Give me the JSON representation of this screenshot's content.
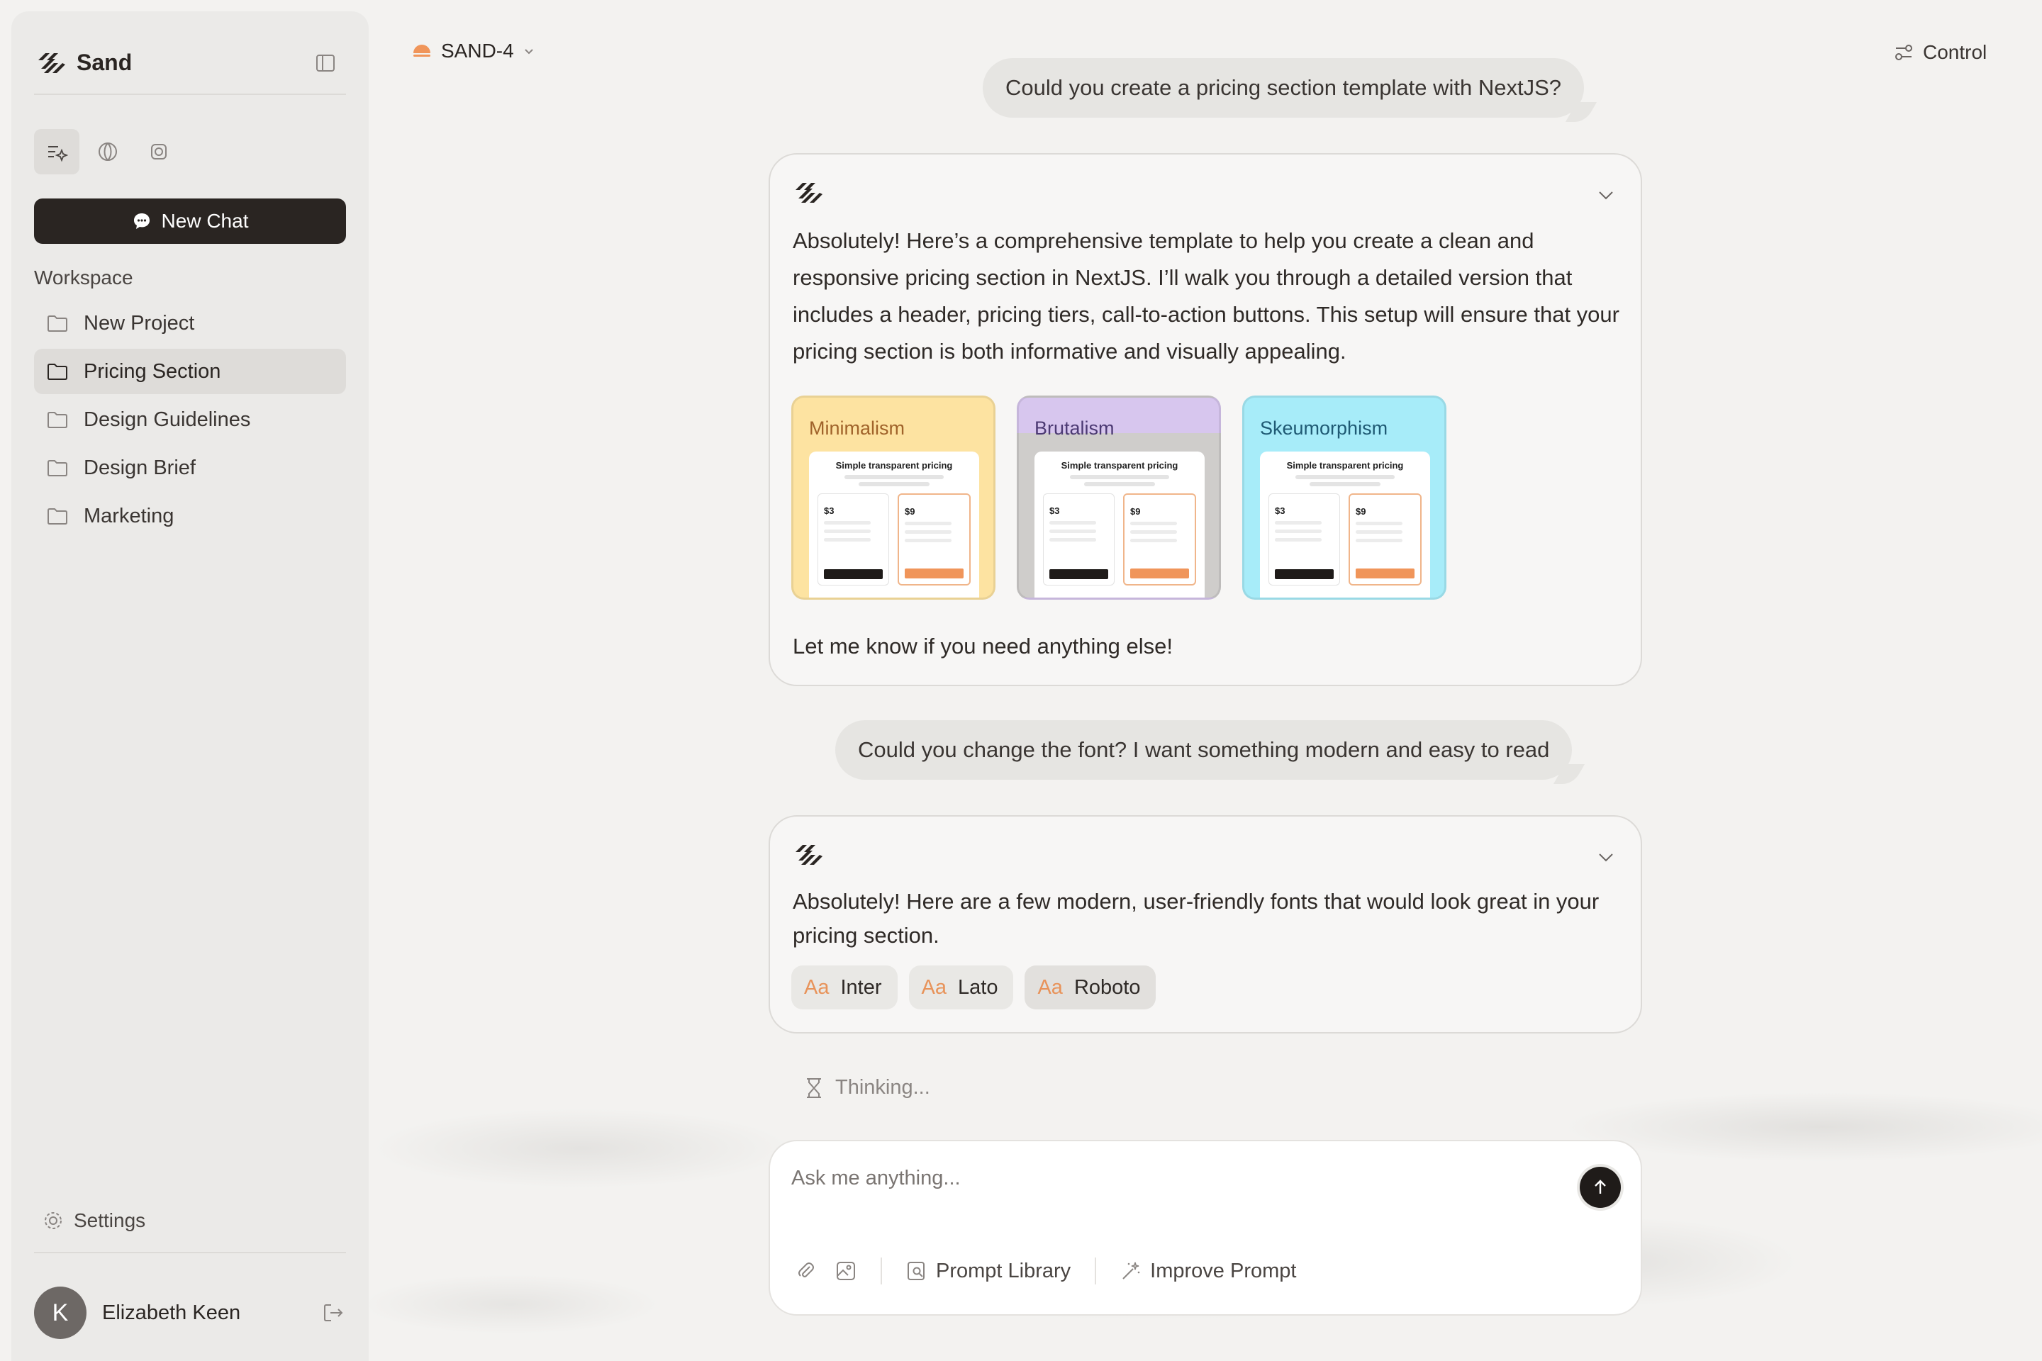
{
  "app": {
    "name": "Sand"
  },
  "sidebar": {
    "new_chat_label": "New Chat",
    "workspace_label": "Workspace",
    "items": [
      {
        "label": "New Project",
        "active": false
      },
      {
        "label": "Pricing Section",
        "active": true
      },
      {
        "label": "Design Guidelines",
        "active": false
      },
      {
        "label": "Design Brief",
        "active": false
      },
      {
        "label": "Marketing",
        "active": false
      }
    ],
    "settings_label": "Settings",
    "user": {
      "name": "Elizabeth Keen",
      "initial": "K"
    }
  },
  "header": {
    "model": "SAND-4",
    "control_label": "Control"
  },
  "chat": {
    "user_messages": [
      "Could you create a pricing section template with NextJS?",
      "Could you change the font? I want something modern and easy to read"
    ],
    "ai_messages": {
      "first": "Absolutely! Here’s a comprehensive template to help you create a clean and responsive pricing section in NextJS. I’ll walk you through a detailed version that includes a header, pricing tiers, call-to-action buttons. This setup will ensure that your pricing section is both informative and visually appealing.",
      "first_footer": "Let me know if you need anything else!",
      "second": "Absolutely! Here are a few modern, user-friendly fonts that would look great in your pricing section."
    },
    "templates": [
      {
        "title": "Minimalism",
        "bg": "#fde3a1",
        "title_color": "#a0632a",
        "card_header": "Simple transparent pricing",
        "price_basic": "$3",
        "price_pro": "$9"
      },
      {
        "title": "Brutalism",
        "bg": "#d7c6ee",
        "title_color": "#4c3a73",
        "card_header": "Simple transparent pricing",
        "price_basic": "$3",
        "price_pro": "$9"
      },
      {
        "title": "Skeumorphism",
        "bg": "#a7ecf9",
        "title_color": "#1f5a74",
        "card_header": "Simple transparent pricing",
        "price_basic": "$3",
        "price_pro": "$9"
      }
    ],
    "fonts": [
      {
        "aa": "Aa",
        "name": "Inter"
      },
      {
        "aa": "Aa",
        "name": "Lato"
      },
      {
        "aa": "Aa",
        "name": "Roboto"
      }
    ],
    "thinking_label": "Thinking..."
  },
  "composer": {
    "placeholder": "Ask me anything...",
    "prompt_library_label": "Prompt Library",
    "improve_prompt_label": "Improve Prompt"
  },
  "colors": {
    "accent": "#e8935a",
    "dark": "#2a2522",
    "background": "#f3f2f0"
  }
}
